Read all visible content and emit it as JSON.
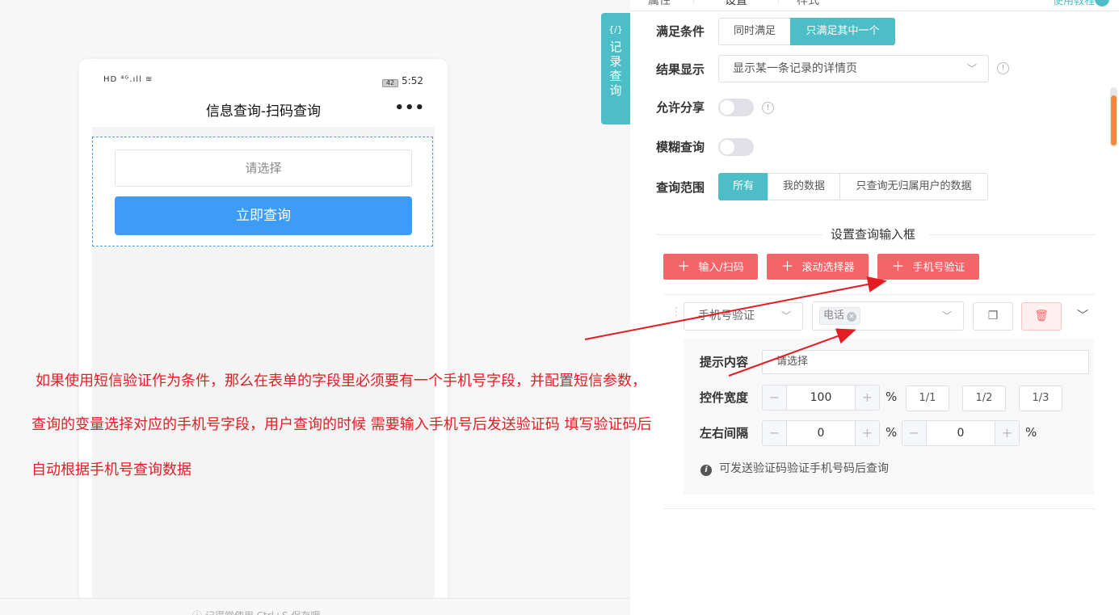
{
  "phone": {
    "status_left": "HD ⁴ᴳ.ıll ≋",
    "battery": "42",
    "time": "5:52",
    "title": "信息查询-扫码查询",
    "more": "•••",
    "select_placeholder": "请选择",
    "query_button": "立即查询"
  },
  "canvas_hint": "ⓘ 记得常使用 Ctrl+S 保存哦",
  "annotation": {
    "line1": "如果使用短信验证作为条件，那么在表单的字段里必须要有一个手机号字段，并配置短信参数，",
    "line2": "查询的变量选择对应的手机号字段，用户查询的时候 需要输入手机号后发送验证码 填写验证码后",
    "line3": "自动根据手机号查询数据"
  },
  "side_tab": {
    "code": "{/}",
    "label": "记录查询"
  },
  "top_tabs": {
    "tab1": "属性",
    "tab2": "设置",
    "tab3": "样式",
    "right_link": "使用教程"
  },
  "settings": {
    "condition": {
      "label": "满足条件",
      "options": [
        "同时满足",
        "只满足其中一个"
      ],
      "active_index": 1
    },
    "result_display": {
      "label": "结果显示",
      "value": "显示某一条记录的详情页"
    },
    "allow_share": {
      "label": "允许分享",
      "enabled": false
    },
    "fuzzy_query": {
      "label": "模糊查询",
      "enabled": false
    },
    "query_scope": {
      "label": "查询范围",
      "options": [
        "所有",
        "我的数据",
        "只查询无归属用户的数据"
      ],
      "active_index": 0
    }
  },
  "input_section": {
    "title": "设置查询输入框",
    "add_buttons": [
      "输入/扫码",
      "滚动选择器",
      "手机号验证"
    ],
    "field": {
      "type": "手机号验证",
      "variable_tag": "电话",
      "prompt_label": "提示内容",
      "prompt_value": "请选择",
      "width_label": "控件宽度",
      "width_value": "100",
      "width_unit": "%",
      "ratios": [
        "1/1",
        "1/2",
        "1/3"
      ],
      "margin_label": "左右间隔",
      "margin_left": "0",
      "margin_right": "0",
      "margin_unit": "%",
      "tip": "可发送验证码验证手机号码后查询"
    }
  },
  "colors": {
    "accent": "#4dbec8",
    "danger": "#f56567",
    "annotation": "#e51c23",
    "primary_button": "#3d9cf5"
  }
}
